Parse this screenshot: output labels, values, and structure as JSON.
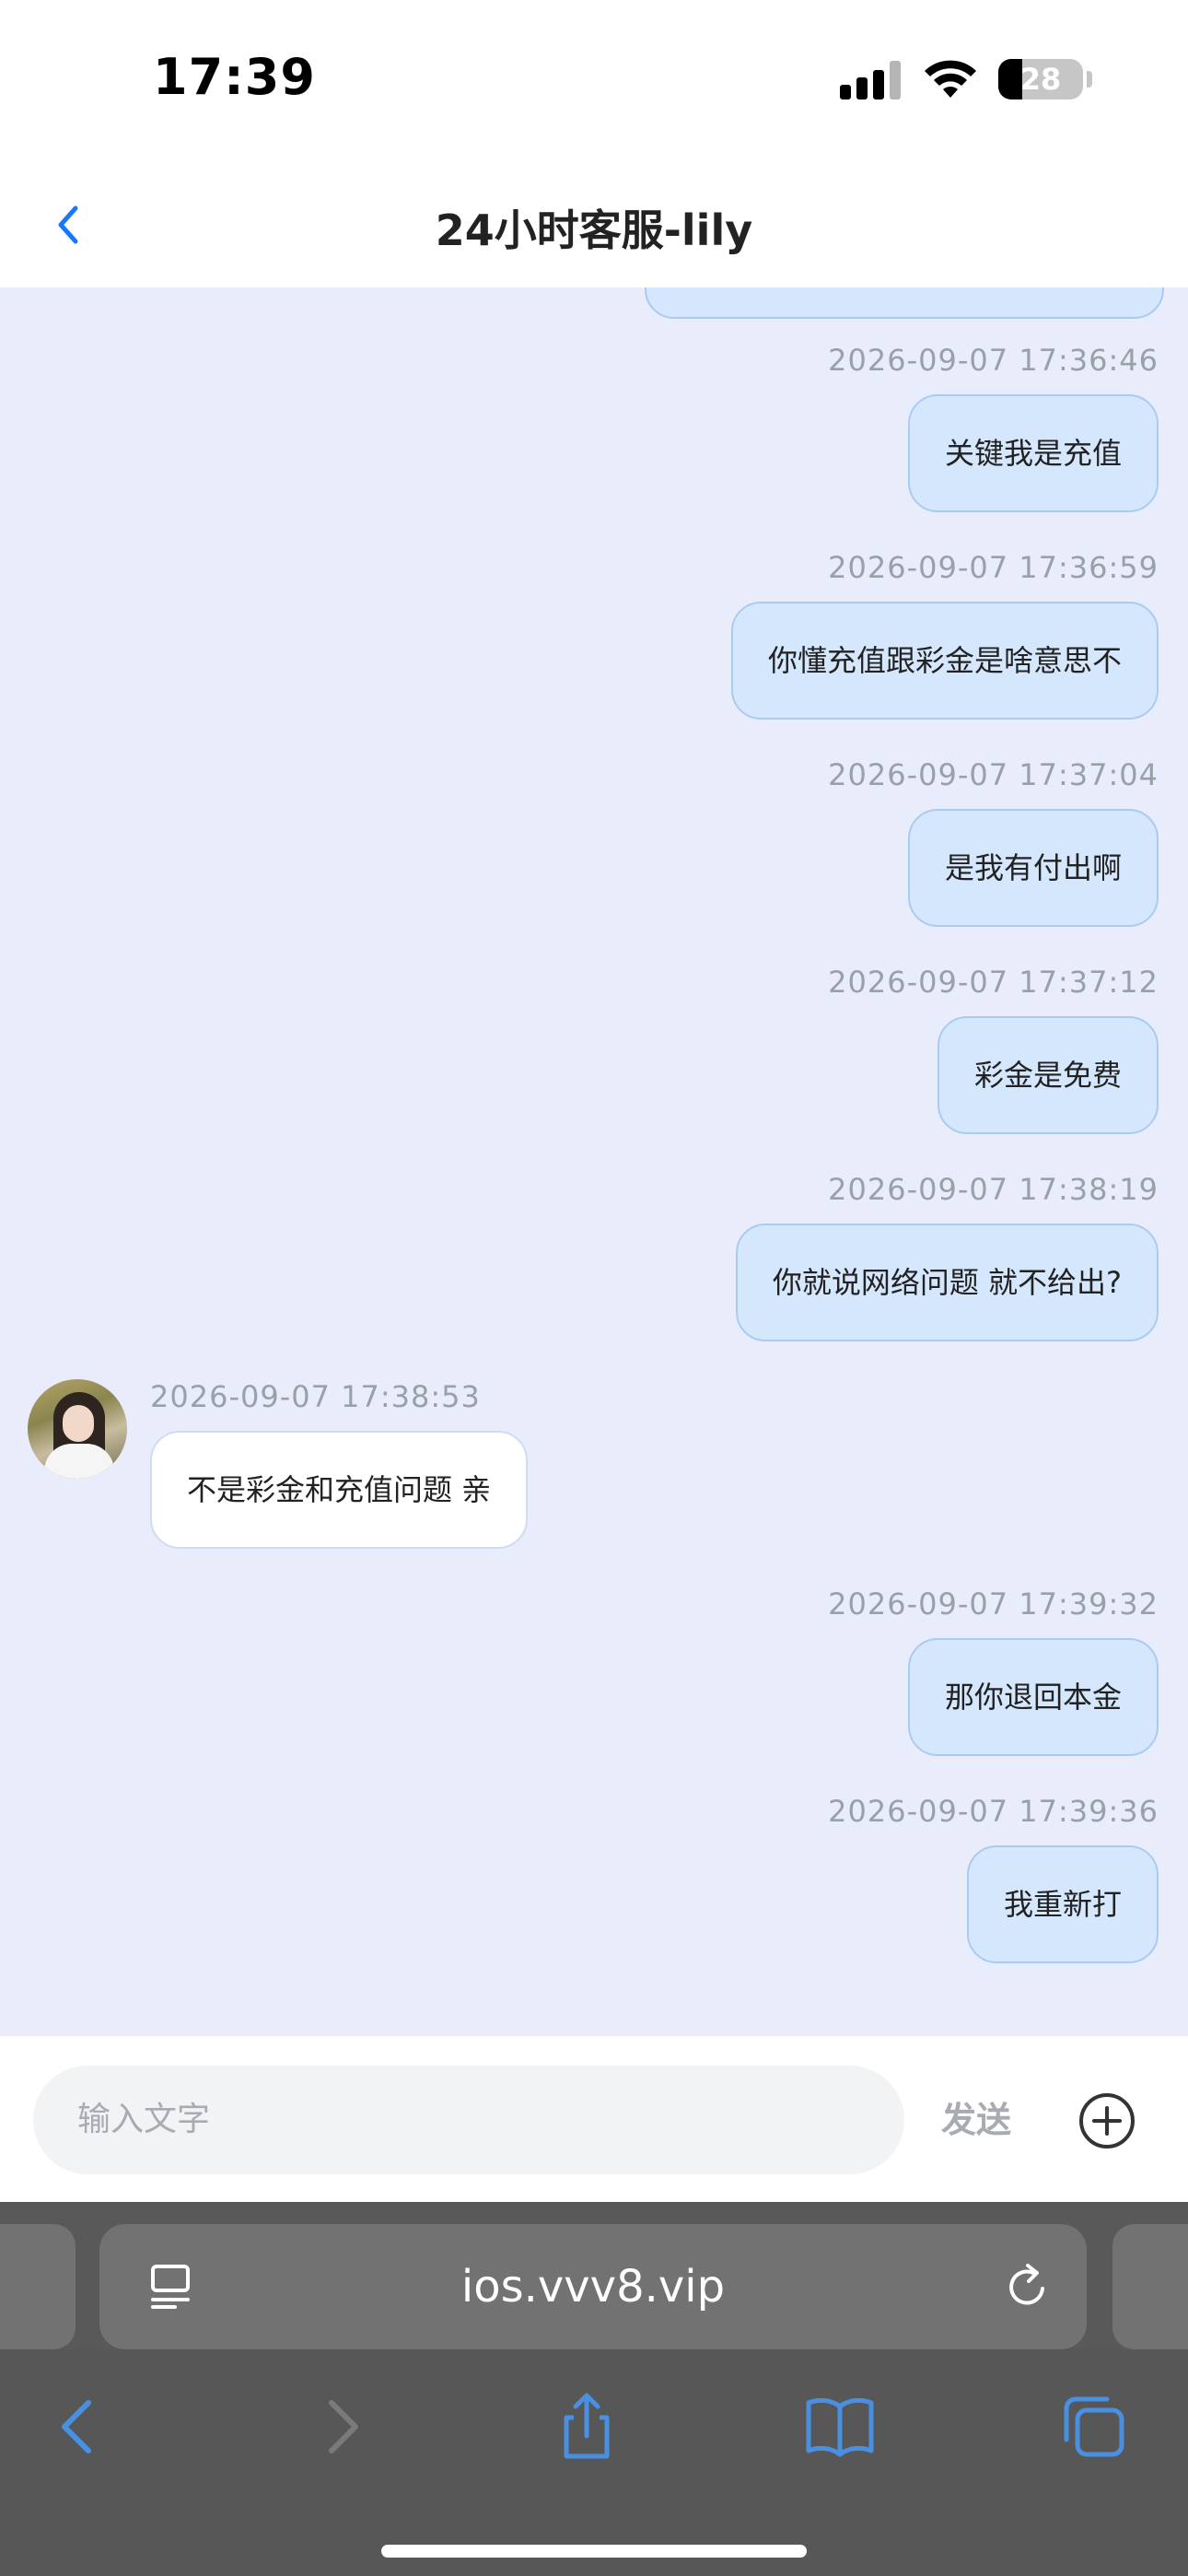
{
  "status_bar": {
    "time": "17:39",
    "battery_level": "28"
  },
  "header": {
    "title": "24小时客服-lily",
    "back_icon": "chevron-left-icon"
  },
  "messages": [
    {
      "from": "me",
      "time": "2026-09-07 17:36:46",
      "text": "关键我是充值"
    },
    {
      "from": "me",
      "time": "2026-09-07 17:36:59",
      "text": "你懂充值跟彩金是啥意思不"
    },
    {
      "from": "me",
      "time": "2026-09-07 17:37:04",
      "text": "是我有付出啊"
    },
    {
      "from": "me",
      "time": "2026-09-07 17:37:12",
      "text": "彩金是免费"
    },
    {
      "from": "me",
      "time": "2026-09-07 17:38:19",
      "text": "你就说网络问题 就不给出?"
    },
    {
      "from": "agent",
      "time": "2026-09-07 17:38:53",
      "text": "不是彩金和充值问题 亲"
    },
    {
      "from": "me",
      "time": "2026-09-07 17:39:32",
      "text": "那你退回本金"
    },
    {
      "from": "me",
      "time": "2026-09-07 17:39:36",
      "text": "我重新打"
    }
  ],
  "composer": {
    "placeholder": "输入文字",
    "send_label": "发送"
  },
  "browser": {
    "url": "ios.vvv8.vip"
  },
  "colors": {
    "chat_bg": "#e9edfb",
    "my_bubble": "#d5e7fd",
    "agent_bubble": "#ffffff",
    "accent": "#1677ff"
  }
}
